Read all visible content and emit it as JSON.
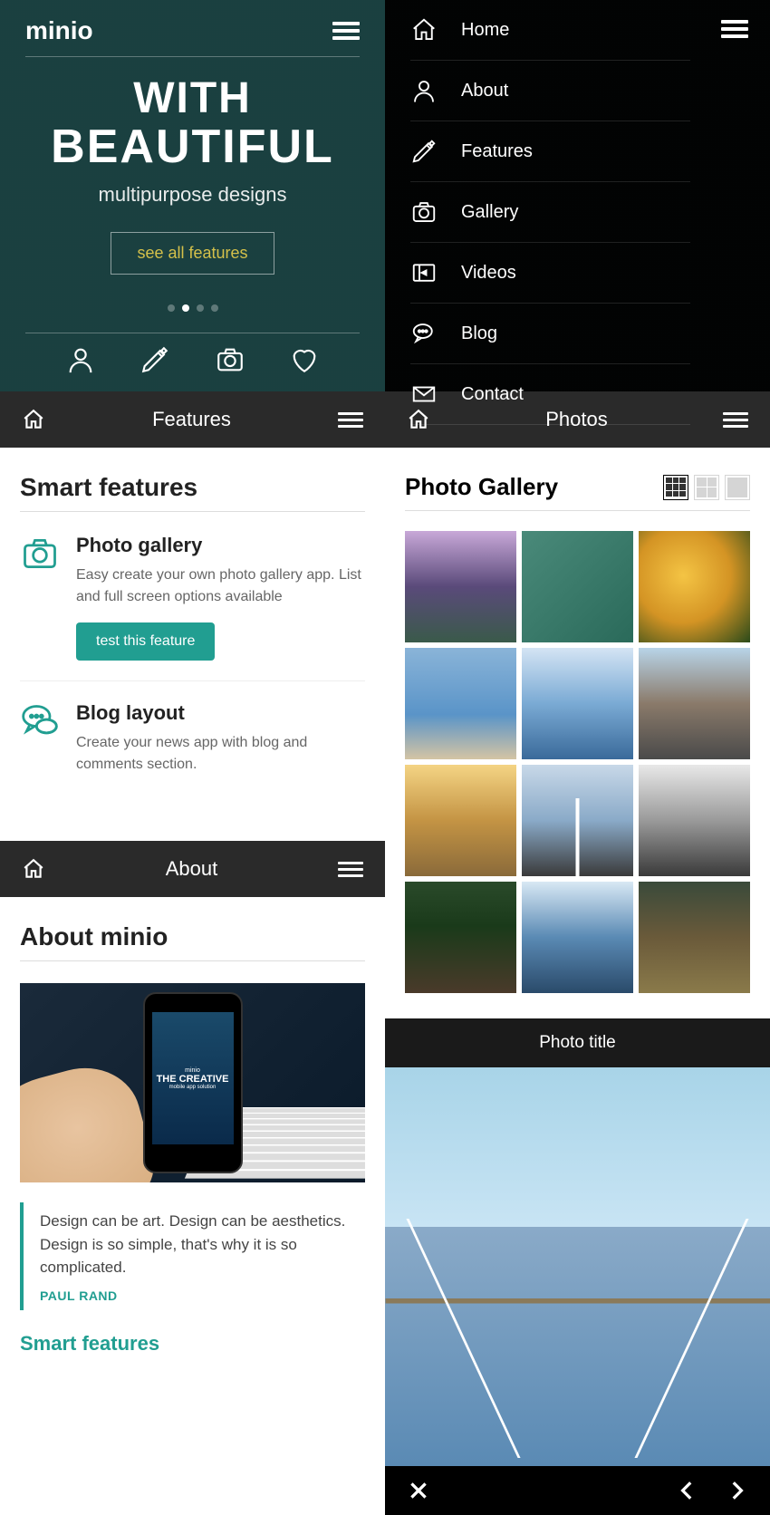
{
  "brand": "minio",
  "hero": {
    "title1": "WITH",
    "title2": "BEAUTIFUL",
    "subtitle": "multipurpose designs",
    "button": "see all features"
  },
  "menu": {
    "items": [
      {
        "label": "Home"
      },
      {
        "label": "About"
      },
      {
        "label": "Features"
      },
      {
        "label": "Gallery"
      },
      {
        "label": "Videos"
      },
      {
        "label": "Blog"
      },
      {
        "label": "Contact"
      }
    ]
  },
  "subbars": {
    "features": "Features",
    "photos": "Photos",
    "about": "About"
  },
  "features": {
    "heading": "Smart features",
    "items": [
      {
        "title": "Photo gallery",
        "desc": "Easy create your own photo gallery app. List and full screen options available",
        "button": "test this feature"
      },
      {
        "title": "Blog layout",
        "desc": "Create your news app with blog and comments section."
      }
    ]
  },
  "about": {
    "heading": "About minio",
    "phone_title": "THE CREATIVE",
    "phone_sub": "mobile app solution",
    "quote": "Design can be art. Design can be aesthetics. Design is so simple, that's why it is so complicated.",
    "author": "PAUL RAND",
    "link": "Smart features"
  },
  "gallery": {
    "heading": "Photo Gallery"
  },
  "viewer": {
    "title": "Photo title"
  }
}
